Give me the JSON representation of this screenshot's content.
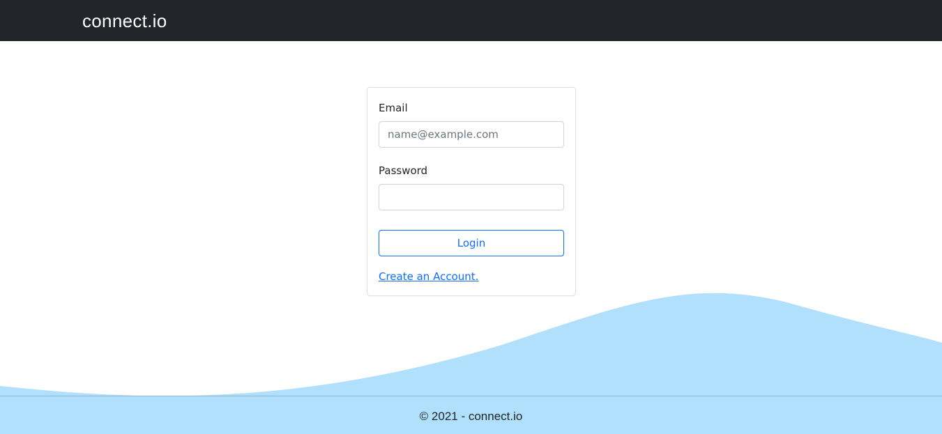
{
  "header": {
    "brand": "connect.io",
    "background_color": "#212529"
  },
  "login_form": {
    "email_label": "Email",
    "email_placeholder": "name@example.com",
    "email_value": "",
    "password_label": "Password",
    "password_value": "",
    "login_button_label": "Login",
    "create_account_link": "Create an Account.",
    "accent_color": "#0d6efd"
  },
  "footer": {
    "text": "© 2021 - connect.io",
    "background_color": "#b0e0fb"
  }
}
